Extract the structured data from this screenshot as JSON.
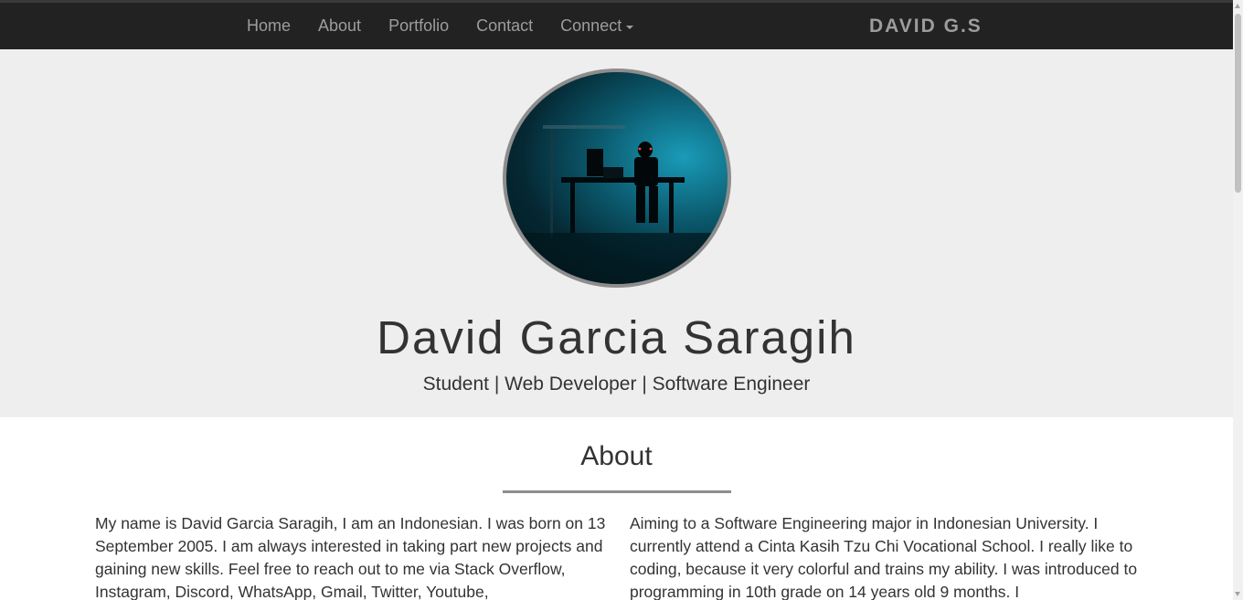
{
  "navbar": {
    "links": [
      "Home",
      "About",
      "Portfolio",
      "Contact"
    ],
    "connect_label": "Connect",
    "brand": "DAVID G.S"
  },
  "hero": {
    "avatar_icon": "profile-photo",
    "name": "David Garcia Saragih",
    "subtitle": "Student | Web Developer | Software Engineer"
  },
  "about": {
    "title": "About",
    "left_text": "My name is David Garcia Saragih, I am an Indonesian. I was born on 13 September 2005. I am always interested in taking part new projects and gaining new skills. Feel free to reach out to me via Stack Overflow, Instagram, Discord, WhatsApp, Gmail, Twitter, Youtube,",
    "right_text": "Aiming to a Software Engineering major in Indonesian University. I currently attend a Cinta Kasih Tzu Chi Vocational School. I really like to coding, because it very colorful and trains my ability. I was introduced to programming in 10th grade on 14 years old 9 months. I"
  },
  "colors": {
    "navbar_bg": "#222222",
    "navbar_text": "#9d9d9d",
    "hero_bg": "#eeeeee",
    "text": "#333333",
    "accent_rule": "#8d8d8d"
  }
}
